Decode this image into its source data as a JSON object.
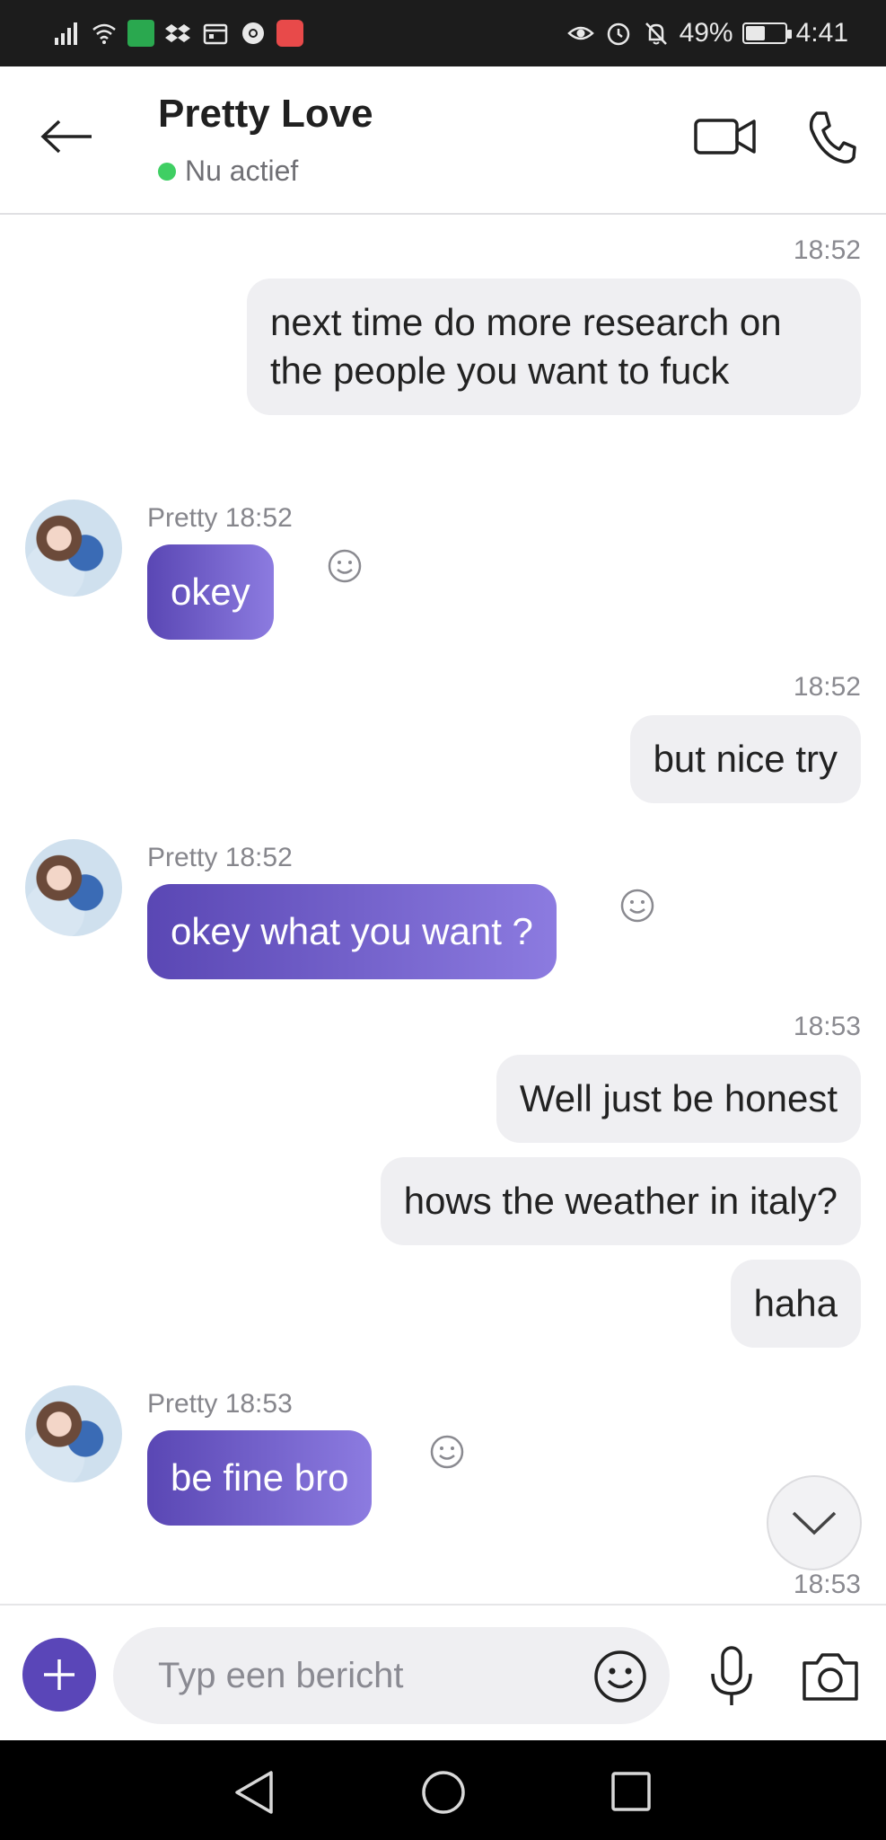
{
  "status_bar": {
    "battery_percent": "49%",
    "battery_level": 0.49,
    "time": "4:41",
    "icons": [
      "signal-icon",
      "wifi-icon",
      "app-icon",
      "dropbox-icon",
      "calendar-icon",
      "chrome-icon",
      "huawei-icon",
      "eye-icon",
      "alarm-icon",
      "bell-off-icon",
      "battery-icon"
    ]
  },
  "header": {
    "contact_name": "Pretty Love",
    "presence": "Nu actief",
    "presence_color": "#3fcf63"
  },
  "messages": [
    {
      "direction": "out",
      "time": "18:52",
      "texts": [
        "next time do more research on the people you want to fuck"
      ]
    },
    {
      "direction": "in",
      "sender": "Pretty",
      "time": "18:52",
      "text": "okey"
    },
    {
      "direction": "out",
      "time": "18:52",
      "texts": [
        "but nice try"
      ]
    },
    {
      "direction": "in",
      "sender": "Pretty",
      "time": "18:52",
      "text": "okey what you want ?"
    },
    {
      "direction": "out",
      "time": "18:53",
      "texts": [
        "Well just be honest",
        "hows the weather in italy?",
        "haha"
      ]
    },
    {
      "direction": "in",
      "sender": "Pretty",
      "time": "18:53",
      "text": "be fine bro"
    },
    {
      "direction": "out",
      "time": "18:53",
      "texts": []
    }
  ],
  "incoming_meta": [
    "Pretty 18:52",
    "Pretty 18:52",
    "Pretty 18:53"
  ],
  "composer": {
    "placeholder": "Typ een bericht"
  },
  "colors": {
    "accent": "#5a46b8",
    "incoming_gradient_start": "#5a47b4",
    "incoming_gradient_end": "#8c7be0",
    "outgoing_bubble": "#efeff2"
  }
}
